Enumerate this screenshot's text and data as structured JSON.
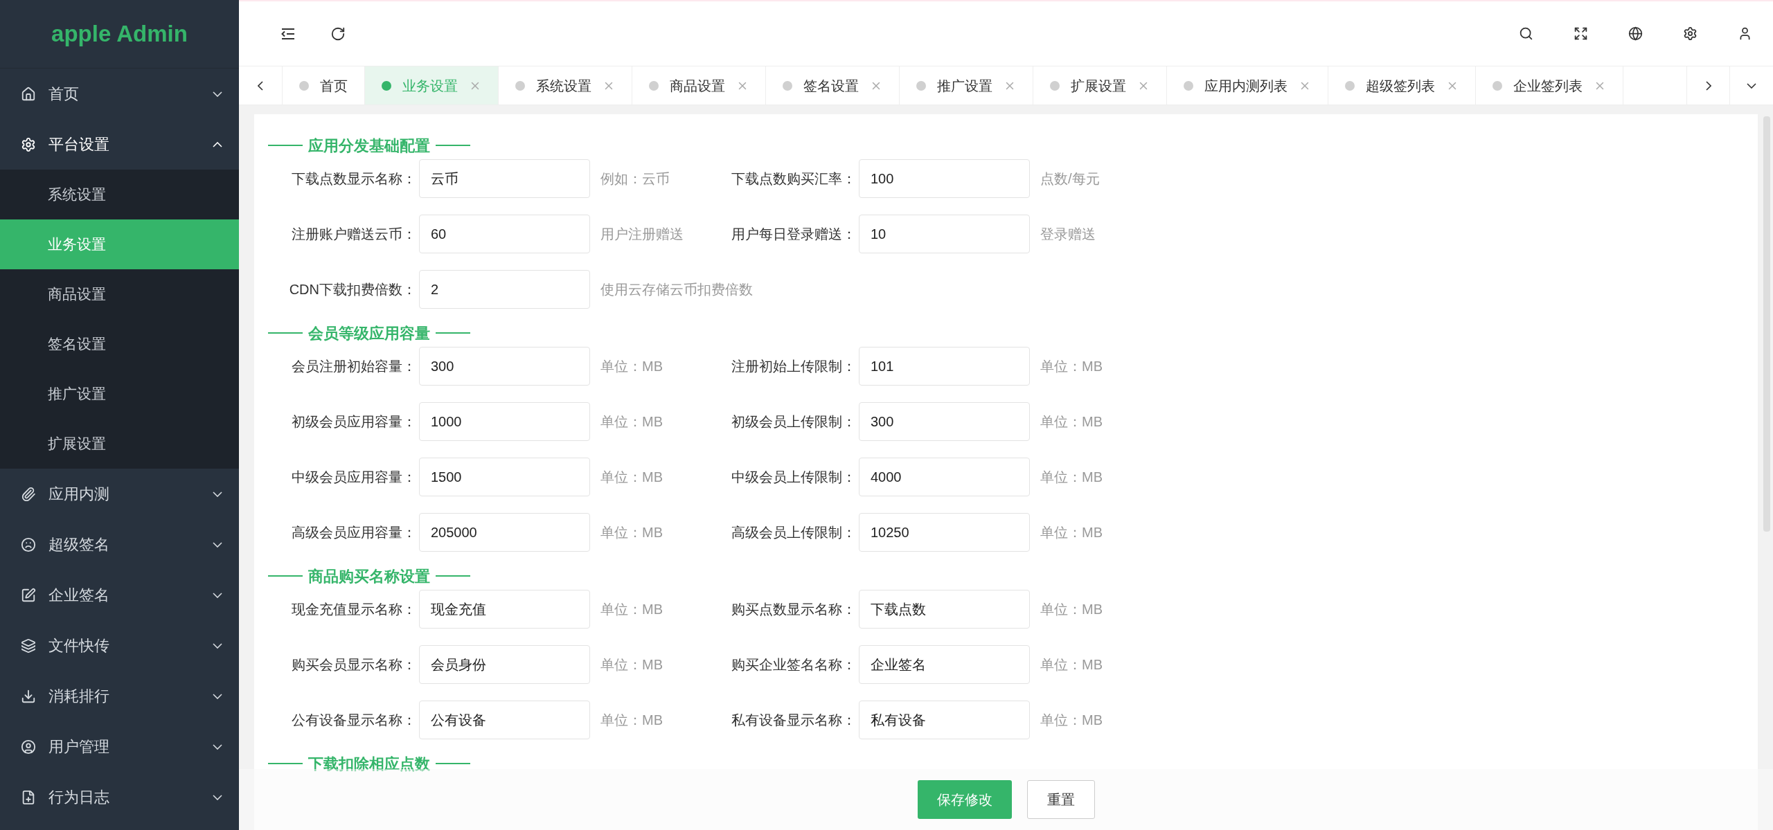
{
  "sidebar": {
    "logo": "apple Admin",
    "items": [
      {
        "label": "首页",
        "expanded": false
      },
      {
        "label": "平台设置",
        "expanded": true,
        "children": [
          {
            "label": "系统设置",
            "selected": false
          },
          {
            "label": "业务设置",
            "selected": true
          },
          {
            "label": "商品设置",
            "selected": false
          },
          {
            "label": "签名设置",
            "selected": false
          },
          {
            "label": "推广设置",
            "selected": false
          },
          {
            "label": "扩展设置",
            "selected": false
          }
        ]
      },
      {
        "label": "应用内测",
        "expanded": false
      },
      {
        "label": "超级签名",
        "expanded": false
      },
      {
        "label": "企业签名",
        "expanded": false
      },
      {
        "label": "文件快传",
        "expanded": false
      },
      {
        "label": "消耗排行",
        "expanded": false
      },
      {
        "label": "用户管理",
        "expanded": false
      },
      {
        "label": "行为日志",
        "expanded": false
      }
    ]
  },
  "tabs": [
    {
      "label": "首页",
      "selected": false,
      "closable": false
    },
    {
      "label": "业务设置",
      "selected": true,
      "closable": true
    },
    {
      "label": "系统设置",
      "selected": false,
      "closable": true
    },
    {
      "label": "商品设置",
      "selected": false,
      "closable": true
    },
    {
      "label": "签名设置",
      "selected": false,
      "closable": true
    },
    {
      "label": "推广设置",
      "selected": false,
      "closable": true
    },
    {
      "label": "扩展设置",
      "selected": false,
      "closable": true
    },
    {
      "label": "应用内测列表",
      "selected": false,
      "closable": true
    },
    {
      "label": "超级签列表",
      "selected": false,
      "closable": true
    },
    {
      "label": "企业签列表",
      "selected": false,
      "closable": true
    }
  ],
  "sections": [
    {
      "title": "应用分发基础配置",
      "rows": [
        [
          {
            "label": "下载点数显示名称：",
            "value": "云币",
            "hint": "例如：云币"
          },
          {
            "label": "下载点数购买汇率：",
            "value": "100",
            "hint": "点数/每元"
          }
        ],
        [
          {
            "label": "注册账户赠送云币：",
            "value": "60",
            "hint": "用户注册赠送"
          },
          {
            "label": "用户每日登录赠送：",
            "value": "10",
            "hint": "登录赠送"
          }
        ],
        [
          {
            "label": "CDN下载扣费倍数：",
            "value": "2",
            "hint": "使用云存储云币扣费倍数"
          }
        ]
      ]
    },
    {
      "title": "会员等级应用容量",
      "rows": [
        [
          {
            "label": "会员注册初始容量：",
            "value": "300",
            "hint": "单位：MB"
          },
          {
            "label": "注册初始上传限制：",
            "value": "101",
            "hint": "单位：MB"
          }
        ],
        [
          {
            "label": "初级会员应用容量：",
            "value": "1000",
            "hint": "单位：MB"
          },
          {
            "label": "初级会员上传限制：",
            "value": "300",
            "hint": "单位：MB"
          }
        ],
        [
          {
            "label": "中级会员应用容量：",
            "value": "1500",
            "hint": "单位：MB"
          },
          {
            "label": "中级会员上传限制：",
            "value": "4000",
            "hint": "单位：MB"
          }
        ],
        [
          {
            "label": "高级会员应用容量：",
            "value": "205000",
            "hint": "单位：MB"
          },
          {
            "label": "高级会员上传限制：",
            "value": "10250",
            "hint": "单位：MB"
          }
        ]
      ]
    },
    {
      "title": "商品购买名称设置",
      "rows": [
        [
          {
            "label": "现金充值显示名称：",
            "value": "现金充值",
            "hint": "单位：MB"
          },
          {
            "label": "购买点数显示名称：",
            "value": "下载点数",
            "hint": "单位：MB"
          }
        ],
        [
          {
            "label": "购买会员显示名称：",
            "value": "会员身份",
            "hint": "单位：MB"
          },
          {
            "label": "购买企业签名名称：",
            "value": "企业签名",
            "hint": "单位：MB"
          }
        ],
        [
          {
            "label": "公有设备显示名称：",
            "value": "公有设备",
            "hint": "单位：MB"
          },
          {
            "label": "私有设备显示名称：",
            "value": "私有设备",
            "hint": "单位：MB"
          }
        ]
      ]
    },
    {
      "title": "下载扣除相应点数"
    }
  ],
  "footer": {
    "buttons": [
      {
        "label": "保存修改",
        "kind": "primary"
      },
      {
        "label": "重置",
        "kind": "default"
      }
    ]
  }
}
